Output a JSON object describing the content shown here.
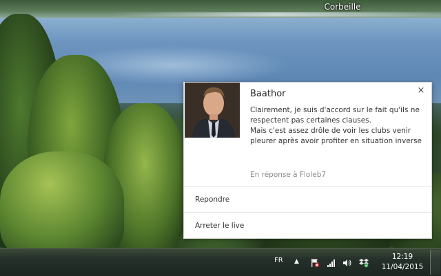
{
  "desktop": {
    "icon_label": "Corbeille"
  },
  "notification": {
    "title": "Baathor",
    "message_lines": [
      "Clairement, je suis d'accord sur le fait qu'ils ne respectent pas certaines clauses.",
      "Mais c'est assez drôle de voir les clubs venir pleurer après avoir profiter en situation inverse"
    ],
    "context": "En réponse à Floleb7",
    "close_symbol": "×",
    "actions": [
      {
        "label": "Repondre"
      },
      {
        "label": "Arreter le live"
      }
    ],
    "avatar_icon": "user-photo"
  },
  "taskbar": {
    "language": "FR",
    "show_hidden_symbol": "▲",
    "clock": {
      "time": "12:19",
      "date": "11/04/2015"
    },
    "tray_icons": [
      "action-center-flag-icon",
      "network-signal-icon",
      "volume-icon",
      "dropbox-icon"
    ]
  }
}
